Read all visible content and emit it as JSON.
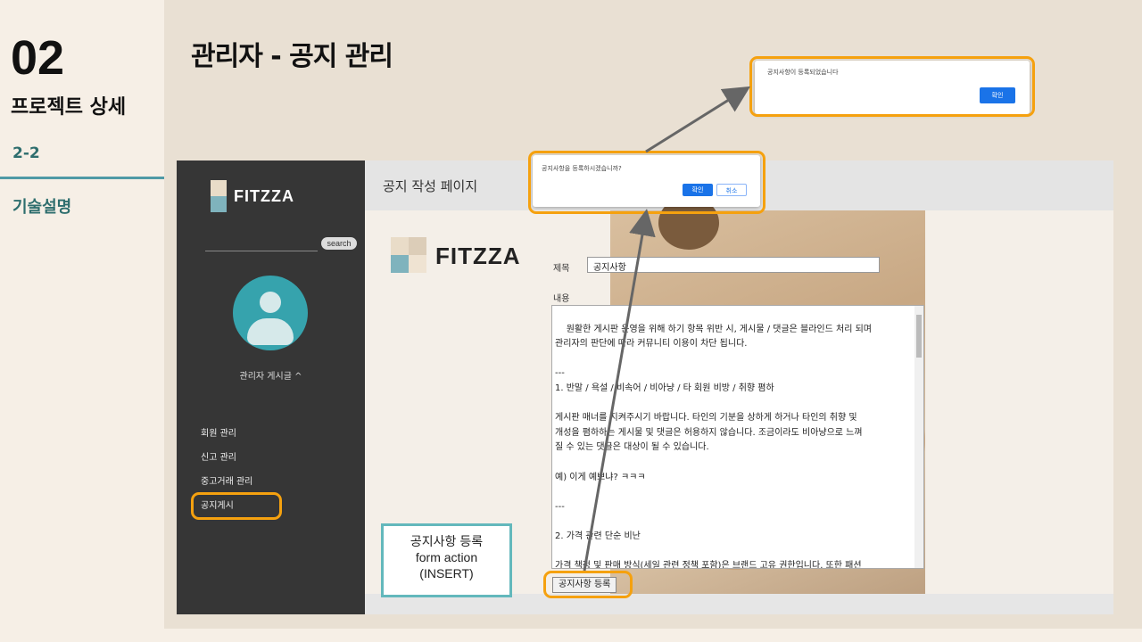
{
  "slide": {
    "number": "02",
    "section": "프로젝트 상세",
    "sub_number": "2-2",
    "sub_title": "기술설명",
    "title": "관리자 - 공지 관리"
  },
  "app": {
    "logo_text": "FITZZA",
    "search_button": "search",
    "user_label": "관리자 게시글 ^",
    "menu": [
      "회원 관리",
      "신고 관리",
      "중고거래 관리",
      "공지게시"
    ],
    "page_title": "공지 작성 페이지",
    "form": {
      "title_label": "제목",
      "title_value": "공지사항",
      "content_label": "내용",
      "content_value": "원활한 게시판 운영을 위해 하기 항목 위반 시, 게시물 / 댓글은 블라인드 처리 되며\n관리자의 판단에 따라 커뮤니티 이용이 차단 됩니다.\n\n---\n1. 반말 / 욕설 / 비속어 / 비아냥 / 타 회원 비방 / 취향 폄하\n\n게시판 매너를 지켜주시기 바랍니다. 타인의 기분을 상하게 하거나 타인의 취향 및\n개성을 폄하하는 게시물 및 댓글은 허용하지 않습니다. 조금이라도 비아냥으로 느껴\n질 수 있는 댓글은 대상이 될 수 있습니다.\n\n예) 이게 예쁘냐? ㅋㅋㅋ\n\n---\n\n2. 가격 관련 단순 비난\n\n가격 책정 및 판매 방식(세일 관련 정책 포함)은 브랜드 고유 권한입니다. 또한 패션\n상품은 같은 품목의 제품끼리도 디자인과 원부자재 및 제작 방식의 차이가 있을 수",
      "submit_label": "공지사항 등록"
    }
  },
  "dialogs": {
    "confirm": {
      "message": "공지사항을 등록하시겠습니까?",
      "ok": "확인",
      "cancel": "취소"
    },
    "alert": {
      "message": "공지사항이 등록되었습니다",
      "ok": "확인"
    }
  },
  "annotation": {
    "line1": "공지사항 등록",
    "line2": "form action",
    "line3": "(INSERT)"
  },
  "colors": {
    "highlight": "#f5a10f",
    "annotation_border": "#63b8bc",
    "accent": "#2e6e6e",
    "dialog_button": "#1a73e8"
  }
}
